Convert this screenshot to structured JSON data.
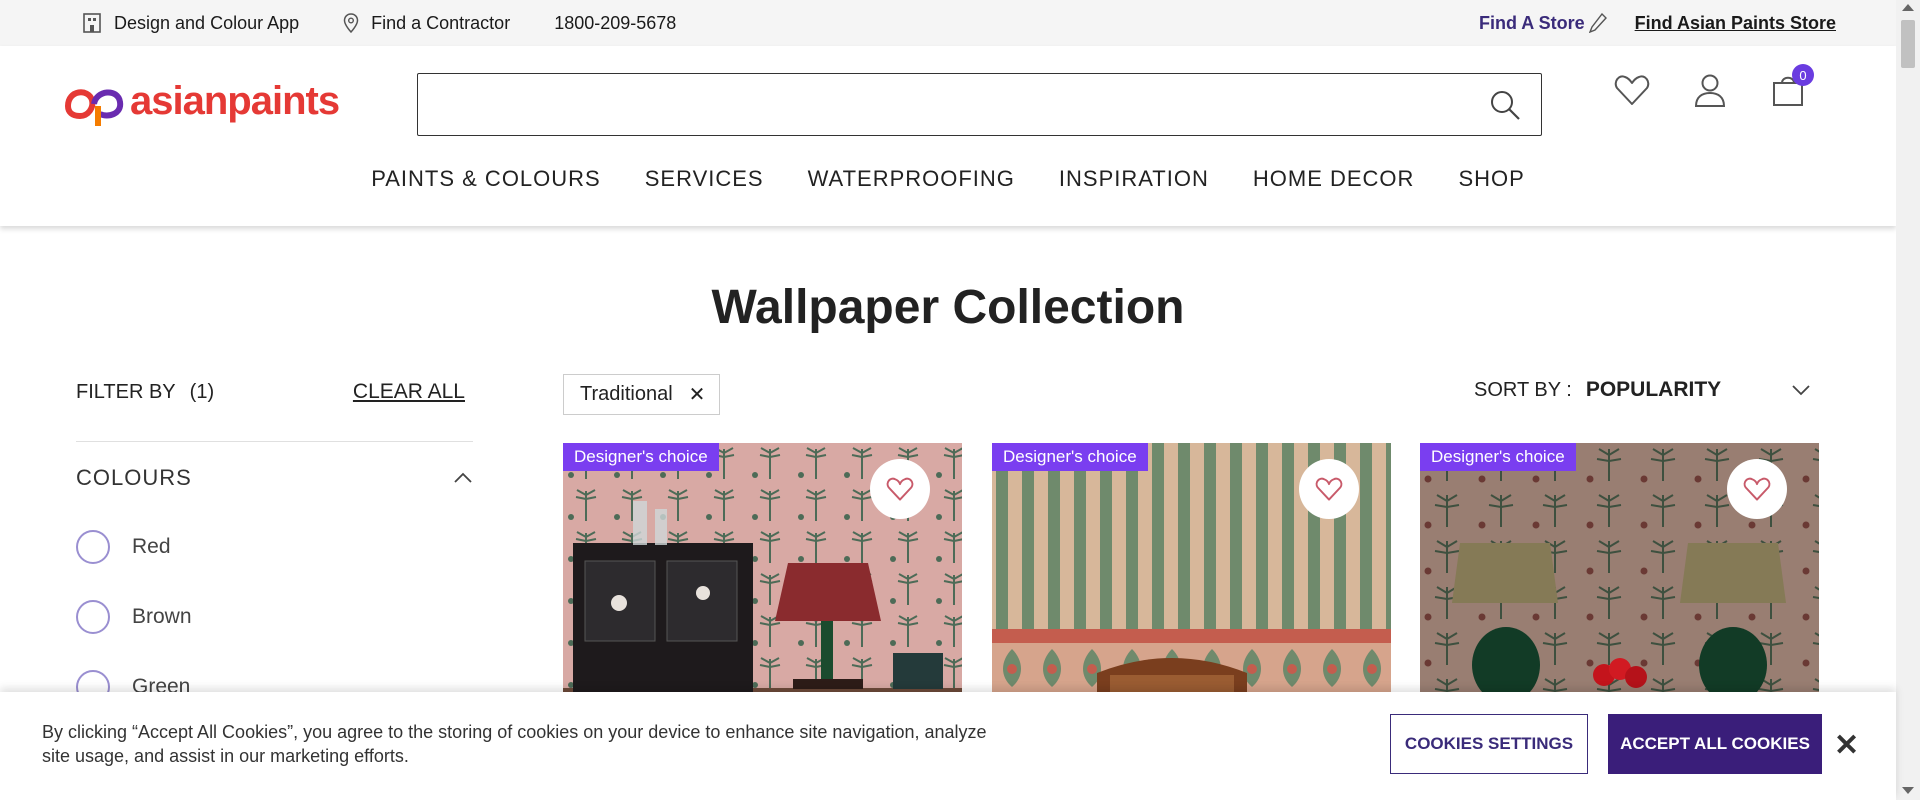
{
  "utility": {
    "design_app": "Design and Colour App",
    "contractor": "Find a Contractor",
    "phone": "1800-209-5678",
    "find_store": "Find A Store",
    "find_ap_store": "Find Asian Paints Store"
  },
  "header": {
    "logo_text": "asianpaints",
    "search_placeholder": "",
    "cart_count": "0"
  },
  "nav": [
    "PAINTS & COLOURS",
    "SERVICES",
    "WATERPROOFING",
    "INSPIRATION",
    "HOME DECOR",
    "SHOP"
  ],
  "page": {
    "title": "Wallpaper Collection"
  },
  "filter": {
    "label": "FILTER BY",
    "count": "(1)",
    "clear": "CLEAR ALL",
    "section": "COLOURS",
    "options": [
      "Red",
      "Brown",
      "Green"
    ]
  },
  "chip": {
    "label": "Traditional"
  },
  "sort": {
    "label": "SORT BY :",
    "value": "POPULARITY"
  },
  "cards": [
    {
      "badge": "Designer's choice"
    },
    {
      "badge": "Designer's choice"
    },
    {
      "badge": "Designer's choice"
    }
  ],
  "cookie": {
    "text": "By clicking “Accept All Cookies”, you agree to the storing of cookies on your device to enhance site navigation, analyze site usage, and assist in our marketing efforts.",
    "settings": "COOKIES SETTINGS",
    "accept": "ACCEPT ALL COOKIES",
    "close": "✕"
  },
  "colors": {
    "brand_red": "#e53935",
    "brand_purple": "#3a1e7a",
    "badge": "#7a3ef0"
  }
}
